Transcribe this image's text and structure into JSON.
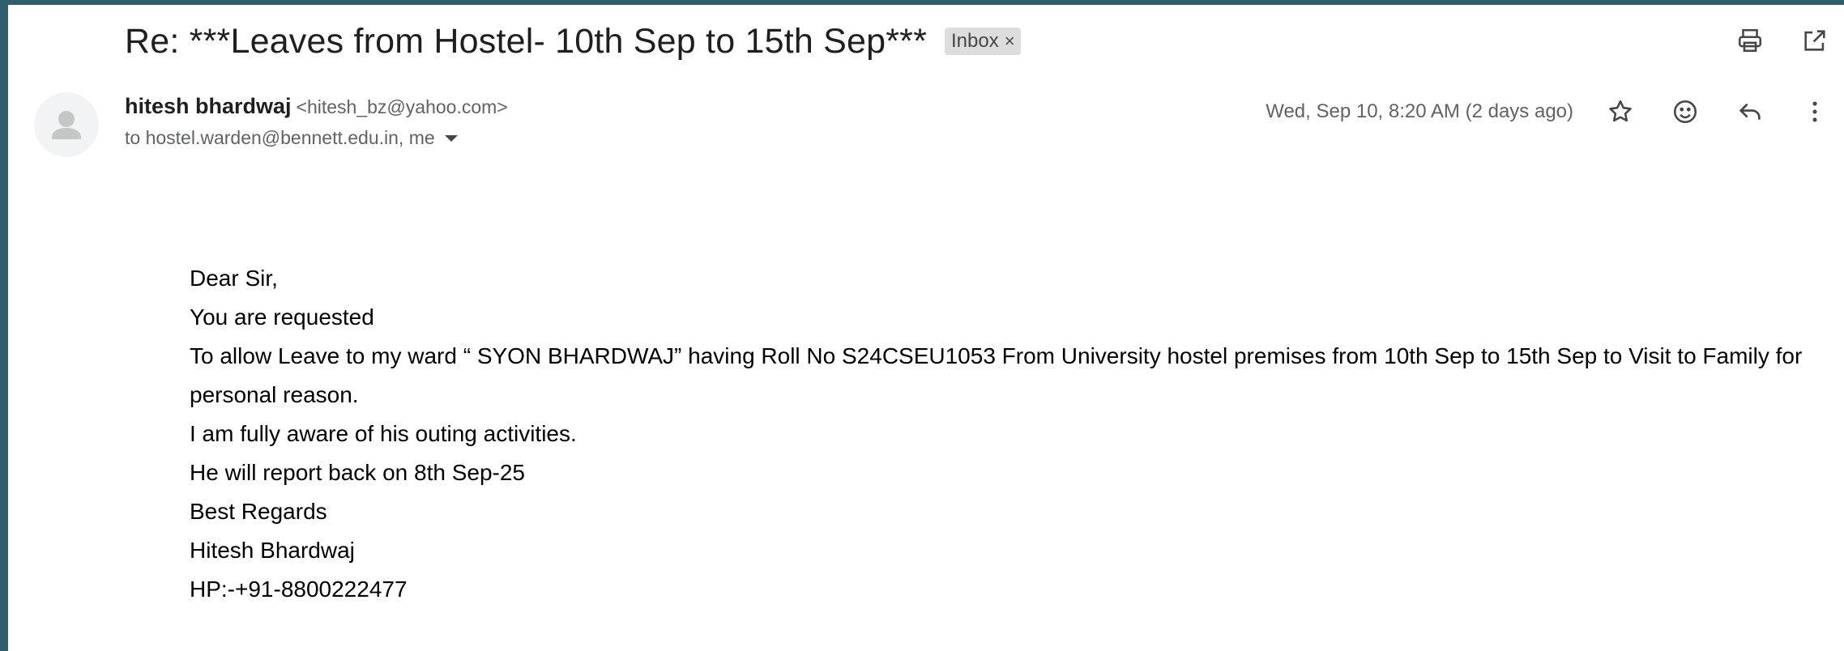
{
  "message": {
    "subject": "Re: ***Leaves from Hostel- 10th Sep to 15th Sep***",
    "label_chip": "Inbox",
    "label_chip_close": "×",
    "sender_name": "hitesh bhardwaj",
    "sender_email": "<hitesh_bz@yahoo.com>",
    "recipients": "to hostel.warden@bennett.edu.in, me",
    "date": "Wed, Sep 10, 8:20 AM (2 days ago)",
    "body_lines": [
      "Dear Sir,",
      "You are requested",
      "To allow Leave to my ward “ SYON BHARDWAJ” having Roll No S24CSEU1053 From University hostel premises from 10th Sep to 15th Sep to Visit to Family for personal reason.",
      "I am fully aware of his outing activities.",
      "He will report back on 8th Sep-25",
      "Best Regards",
      "Hitesh Bhardwaj",
      "HP:-+91-8800222477"
    ]
  },
  "icons": {
    "print": "print-icon",
    "open_new_window": "open-in-new-window-icon",
    "star": "star-icon",
    "emoji": "emoji-reaction-icon",
    "reply": "reply-icon",
    "more": "more-vertical-icon",
    "avatar": "person-avatar-icon"
  },
  "colors": {
    "background_edge": "#2f5f6e",
    "chip_bg": "#dddddd",
    "secondary_text": "#5f6368",
    "icon": "#444746"
  }
}
